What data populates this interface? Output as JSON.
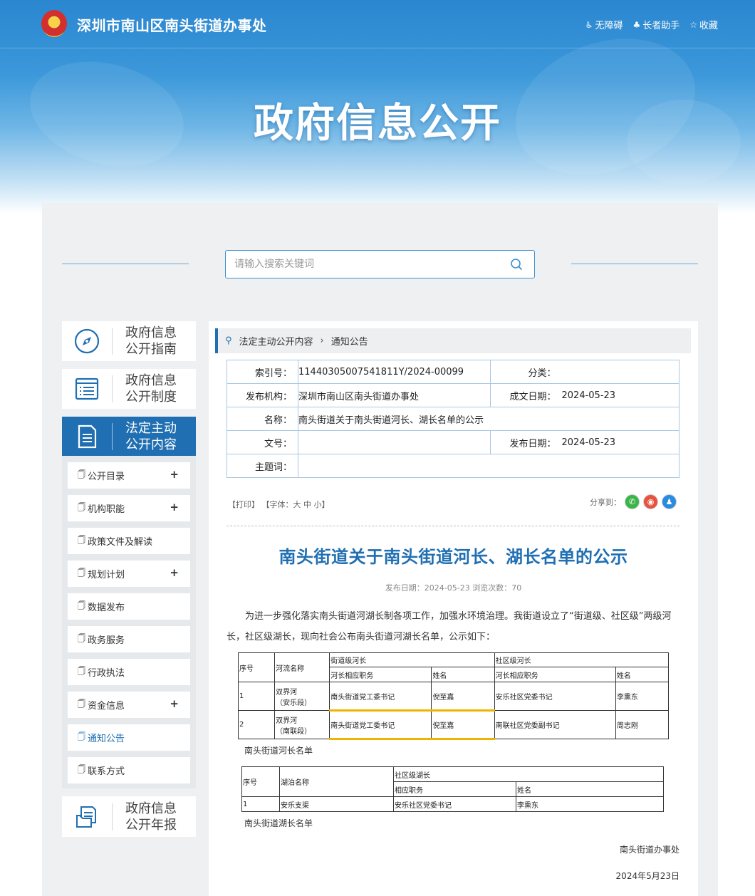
{
  "header": {
    "site_title": "深圳市南山区南头街道办事处",
    "links": [
      {
        "icon": "accessibility-icon",
        "label": "无障碍"
      },
      {
        "icon": "elder-icon",
        "label": "长者助手"
      },
      {
        "icon": "star-icon",
        "label": "收藏"
      }
    ],
    "banner_title": "政府信息公开"
  },
  "search": {
    "placeholder": "请输入搜索关键词"
  },
  "sidebar": {
    "cards": [
      {
        "label": "政府信息\n公开指南",
        "icon": "compass-icon"
      },
      {
        "label": "政府信息\n公开制度",
        "icon": "list-icon"
      },
      {
        "label": "法定主动\n公开内容",
        "icon": "document-icon"
      },
      {
        "label": "政府信息\n公开年报",
        "icon": "report-icon"
      }
    ],
    "items": [
      {
        "label": "公开目录",
        "expandable": true
      },
      {
        "label": "机构职能",
        "expandable": true
      },
      {
        "label": "政策文件及解读",
        "expandable": false
      },
      {
        "label": "规划计划",
        "expandable": true
      },
      {
        "label": "数据发布",
        "expandable": false
      },
      {
        "label": "政务服务",
        "expandable": false
      },
      {
        "label": "行政执法",
        "expandable": false
      },
      {
        "label": "资金信息",
        "expandable": true
      },
      {
        "label": "通知公告",
        "expandable": false
      },
      {
        "label": "联系方式",
        "expandable": false
      }
    ],
    "plus": "+"
  },
  "breadcrumb": {
    "first": "法定主动公开内容",
    "sep": "›",
    "second": "通知公告"
  },
  "meta": {
    "index_label": "索引号：",
    "index_value": "11440305007541811Y/2024-00099",
    "category_label": "分类：",
    "category_value": "",
    "publisher_label": "发布机构：",
    "publisher_value": "深圳市南山区南头街道办事处",
    "created_label": "成文日期：",
    "created_value": "2024-05-23",
    "name_label": "名称：",
    "name_value": "南头街道关于南头街道河长、湖长名单的公示",
    "docno_label": "文号：",
    "docno_value": "",
    "pubdate_label": "发布日期：",
    "pubdate_value": "2024-05-23",
    "keywords_label": "主题词：",
    "keywords_value": ""
  },
  "toolbar": {
    "print": "【打印】",
    "font": "【字体：大  中  小】",
    "share_label": "分享到："
  },
  "article": {
    "title": "南头街道关于南头街道河长、湖长名单的公示",
    "meta": "发布日期：2024-05-23  浏览次数：70",
    "paragraph": "为进一步强化落实南头街道河湖长制各项工作，加强水环境治理。我街道设立了“街道级、社区级”两级河长，社区级湖长，现向社会公布南头街道河湖长名单，公示如下：",
    "river_table": {
      "h_no": "序号",
      "h_name": "河流名称",
      "h_street": "街道级河长",
      "h_community": "社区级河长",
      "h_post": "河长相应职务",
      "h_person": "姓名",
      "rows": [
        {
          "no": "1",
          "river": "双界河",
          "section": "（安乐段）",
          "s_post": "南头街道党工委书记",
          "s_name": "倪至嘉",
          "c_post": "安乐社区党委书记",
          "c_name": "李熏东"
        },
        {
          "no": "2",
          "river": "双界河",
          "section": "（南联段）",
          "s_post": "南头街道党工委书记",
          "s_name": "倪至嘉",
          "c_post": "南联社区党委副书记",
          "c_name": "周志刚"
        }
      ],
      "caption": "南头街道河长名单"
    },
    "lake_table": {
      "h_no": "序号",
      "h_name": "湖泊名称",
      "h_community": "社区级湖长",
      "h_post": "相应职务",
      "h_person": "姓名",
      "rows": [
        {
          "no": "1",
          "lake": "安乐支渠",
          "post": "安乐社区党委书记",
          "name": "李熏东"
        }
      ],
      "caption": "南头街道湖长名单"
    },
    "signature": "南头街道办事处",
    "date": "2024年5月23日"
  }
}
